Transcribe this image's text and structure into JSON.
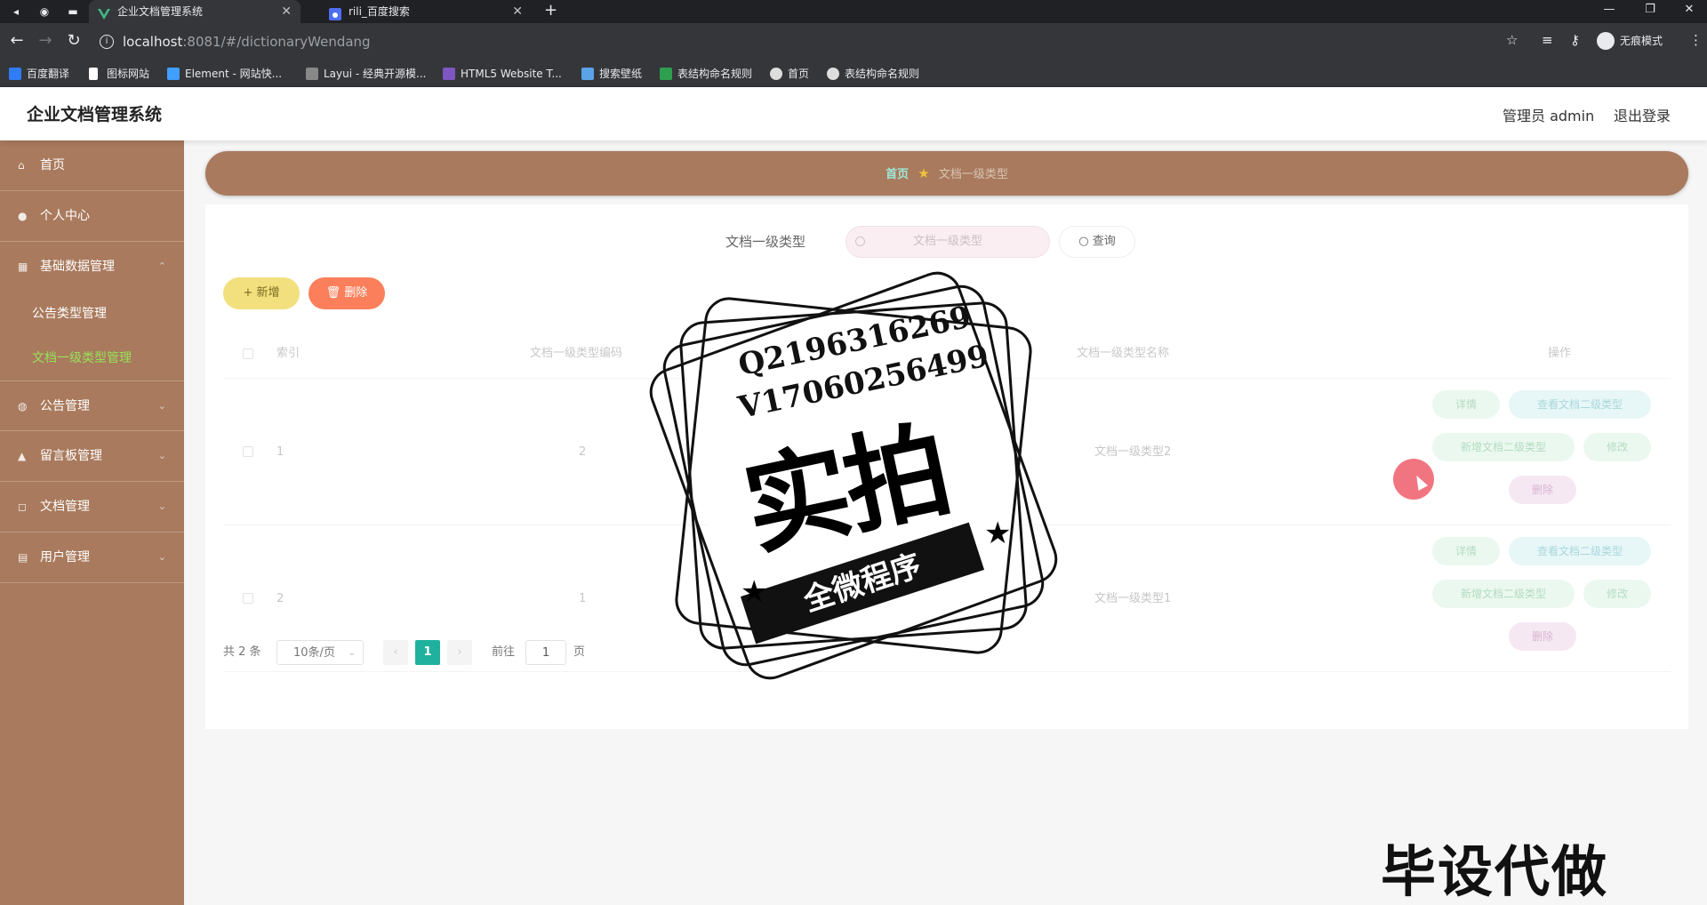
{
  "browser": {
    "tabs": [
      {
        "label": "企业文档管理系统",
        "active": true
      },
      {
        "label": "rili_百度搜索",
        "active": false
      }
    ],
    "url_host": "localhost",
    "url_path": ":8081/#/dictionaryWendang",
    "incognito_label": "无痕模式",
    "bookmarks": [
      "百度翻译",
      "图标网站",
      "Element - 网站快...",
      "Layui - 经典开源模...",
      "HTML5 Website T...",
      "搜索壁纸",
      "表结构命名规则",
      "首页",
      "表结构命名规则"
    ]
  },
  "header": {
    "title": "企业文档管理系统",
    "admin_label": "管理员 admin",
    "logout_label": "退出登录"
  },
  "sidebar": {
    "items": [
      {
        "label": "首页",
        "icon": "home-icon"
      },
      {
        "label": "个人中心",
        "icon": "user-icon"
      },
      {
        "label": "基础数据管理",
        "icon": "grid-icon"
      },
      {
        "label": "公告类型管理"
      },
      {
        "label": "文档一级类型管理",
        "active": true
      },
      {
        "label": "公告管理",
        "icon": "bell-icon"
      },
      {
        "label": "留言板管理",
        "icon": "message-icon"
      },
      {
        "label": "文档管理",
        "icon": "document-icon"
      },
      {
        "label": "用户管理",
        "icon": "users-icon"
      }
    ]
  },
  "breadcrumb": {
    "home": "首页",
    "current": "文档一级类型"
  },
  "search": {
    "label": "文档一级类型",
    "placeholder": "文档一级类型",
    "query_label": "查询"
  },
  "actions": {
    "add_label": "新增",
    "delete_label": "删除"
  },
  "table": {
    "columns": [
      "索引",
      "文档一级类型编码",
      "文档一级类型名称",
      "操作"
    ],
    "rows": [
      {
        "index": "1",
        "code": "2",
        "name": "文档一级类型2"
      },
      {
        "index": "2",
        "code": "1",
        "name": "文档一级类型1"
      }
    ],
    "ops": {
      "detail": "详情",
      "view_sub": "查看文档二级类型",
      "add_sub": "新增文档二级类型",
      "edit": "修改",
      "delete": "删除"
    }
  },
  "pagination": {
    "total": "共 2 条",
    "page_size": "10条/页",
    "current_page": "1",
    "goto_prefix": "前往",
    "goto_value": "1",
    "goto_suffix": "页"
  },
  "watermark": {
    "line1": "Q2196316269",
    "line2": "V17060256499",
    "big": "实拍",
    "ribbon": "全微程序",
    "bottom": "毕设代做"
  },
  "colors": {
    "sidebar": "#a97a5d",
    "accent_green": "#97e05a",
    "page_active": "#1fb19e",
    "add_btn": "#f2e07e",
    "delete_btn": "#fb7f5b"
  }
}
